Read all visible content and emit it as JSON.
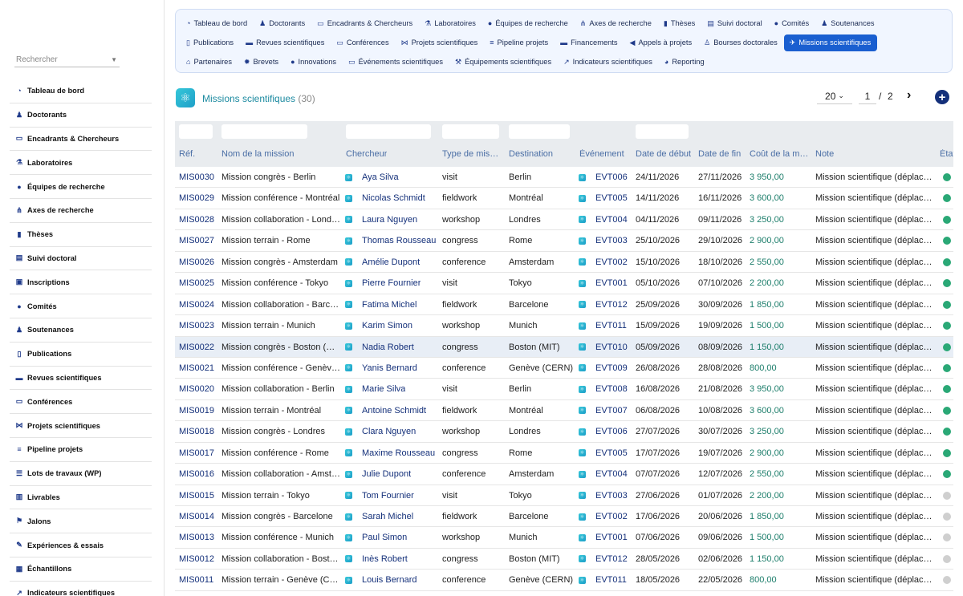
{
  "sidebar": {
    "search_placeholder": "Rechercher",
    "items": [
      {
        "label": "Tableau de bord",
        "icon": "dashboard-icon"
      },
      {
        "label": "Doctorants",
        "icon": "student-icon"
      },
      {
        "label": "Encadrants & Chercheurs",
        "icon": "researcher-icon"
      },
      {
        "label": "Laboratoires",
        "icon": "flask-icon"
      },
      {
        "label": "Équipes de recherche",
        "icon": "team-icon"
      },
      {
        "label": "Axes de recherche",
        "icon": "sitemap-icon"
      },
      {
        "label": "Thèses",
        "icon": "book-icon"
      },
      {
        "label": "Suivi doctoral",
        "icon": "clipboard-icon"
      },
      {
        "label": "Inscriptions",
        "icon": "id-card-icon"
      },
      {
        "label": "Comités",
        "icon": "committee-icon"
      },
      {
        "label": "Soutenances",
        "icon": "presenter-icon"
      },
      {
        "label": "Publications",
        "icon": "open-book-icon"
      },
      {
        "label": "Revues scientifiques",
        "icon": "journal-icon"
      },
      {
        "label": "Conférences",
        "icon": "conference-icon"
      },
      {
        "label": "Projets scientifiques",
        "icon": "project-icon"
      },
      {
        "label": "Pipeline projets",
        "icon": "pipeline-icon"
      },
      {
        "label": "Lots de travaux (WP)",
        "icon": "tasks-icon"
      },
      {
        "label": "Livrables",
        "icon": "deliverable-icon"
      },
      {
        "label": "Jalons",
        "icon": "flag-icon"
      },
      {
        "label": "Expériences & essais",
        "icon": "pen-icon"
      },
      {
        "label": "Échantillons",
        "icon": "sample-icon"
      },
      {
        "label": "Indicateurs scientifiques",
        "icon": "chart-icon"
      }
    ]
  },
  "topnav": {
    "rows": [
      [
        {
          "label": "Tableau de bord",
          "icon": "dashboard-icon"
        },
        {
          "label": "Doctorants",
          "icon": "student-icon"
        },
        {
          "label": "Encadrants & Chercheurs",
          "icon": "researcher-icon"
        },
        {
          "label": "Laboratoires",
          "icon": "flask-icon"
        },
        {
          "label": "Équipes de recherche",
          "icon": "team-icon"
        },
        {
          "label": "Axes de recherche",
          "icon": "sitemap-icon"
        },
        {
          "label": "Thèses",
          "icon": "book-icon"
        },
        {
          "label": "Suivi doctoral",
          "icon": "clipboard-icon"
        },
        {
          "label": "Comités",
          "icon": "committee-icon"
        },
        {
          "label": "Soutenances",
          "icon": "presenter-icon"
        }
      ],
      [
        {
          "label": "Publications",
          "icon": "open-book-icon"
        },
        {
          "label": "Revues scientifiques",
          "icon": "journal-icon"
        },
        {
          "label": "Conférences",
          "icon": "conference-icon"
        },
        {
          "label": "Projets scientifiques",
          "icon": "project-icon"
        },
        {
          "label": "Pipeline projets",
          "icon": "pipeline-icon"
        },
        {
          "label": "Financements",
          "icon": "money-icon"
        },
        {
          "label": "Appels à projets",
          "icon": "megaphone-icon"
        },
        {
          "label": "Bourses doctorales",
          "icon": "grant-icon"
        },
        {
          "label": "Missions scientifiques",
          "icon": "plane-icon",
          "active": true
        }
      ],
      [
        {
          "label": "Partenaires",
          "icon": "institution-icon"
        },
        {
          "label": "Brevets",
          "icon": "certificate-icon"
        },
        {
          "label": "Innovations",
          "icon": "lightbulb-icon"
        },
        {
          "label": "Événements scientifiques",
          "icon": "event-icon"
        },
        {
          "label": "Équipements scientifiques",
          "icon": "equipment-icon"
        },
        {
          "label": "Indicateurs scientifiques",
          "icon": "chart-icon"
        },
        {
          "label": "Reporting",
          "icon": "pie-chart-icon"
        }
      ]
    ]
  },
  "header": {
    "title": "Missions scientifiques",
    "count": "(30)",
    "per_page": "20",
    "page": "1",
    "slash": "/",
    "total_pages": "2"
  },
  "table": {
    "columns": [
      "Réf.",
      "Nom de la mission",
      "Chercheur",
      "Type de mis…",
      "Destination",
      "Événement",
      "Date de début",
      "Date de fin",
      "Coût de la m…",
      "Note",
      "État"
    ],
    "colors": {
      "done": "#2aa876",
      "pending": "#cfcfcf"
    },
    "rows": [
      {
        "ref": "MIS0030",
        "name": "Mission congrès - Berlin",
        "researcher": "Aya Silva",
        "type": "visit",
        "dest": "Berlin",
        "event": "EVT006",
        "start": "24/11/2026",
        "end": "27/11/2026",
        "cost": "3 950,00",
        "note": "Mission scientifique (déplac…",
        "status": "done"
      },
      {
        "ref": "MIS0029",
        "name": "Mission conférence - Montréal",
        "researcher": "Nicolas Schmidt",
        "type": "fieldwork",
        "dest": "Montréal",
        "event": "EVT005",
        "start": "14/11/2026",
        "end": "16/11/2026",
        "cost": "3 600,00",
        "note": "Mission scientifique (déplac…",
        "status": "done"
      },
      {
        "ref": "MIS0028",
        "name": "Mission collaboration - Lond…",
        "researcher": "Laura Nguyen",
        "type": "workshop",
        "dest": "Londres",
        "event": "EVT004",
        "start": "04/11/2026",
        "end": "09/11/2026",
        "cost": "3 250,00",
        "note": "Mission scientifique (déplac…",
        "status": "done"
      },
      {
        "ref": "MIS0027",
        "name": "Mission terrain - Rome",
        "researcher": "Thomas Rousseau",
        "type": "congress",
        "dest": "Rome",
        "event": "EVT003",
        "start": "25/10/2026",
        "end": "29/10/2026",
        "cost": "2 900,00",
        "note": "Mission scientifique (déplac…",
        "status": "done"
      },
      {
        "ref": "MIS0026",
        "name": "Mission congrès - Amsterdam",
        "researcher": "Amélie Dupont",
        "type": "conference",
        "dest": "Amsterdam",
        "event": "EVT002",
        "start": "15/10/2026",
        "end": "18/10/2026",
        "cost": "2 550,00",
        "note": "Mission scientifique (déplac…",
        "status": "done"
      },
      {
        "ref": "MIS0025",
        "name": "Mission conférence - Tokyo",
        "researcher": "Pierre Fournier",
        "type": "visit",
        "dest": "Tokyo",
        "event": "EVT001",
        "start": "05/10/2026",
        "end": "07/10/2026",
        "cost": "2 200,00",
        "note": "Mission scientifique (déplac…",
        "status": "done"
      },
      {
        "ref": "MIS0024",
        "name": "Mission collaboration - Barc…",
        "researcher": "Fatima Michel",
        "type": "fieldwork",
        "dest": "Barcelone",
        "event": "EVT012",
        "start": "25/09/2026",
        "end": "30/09/2026",
        "cost": "1 850,00",
        "note": "Mission scientifique (déplac…",
        "status": "done"
      },
      {
        "ref": "MIS0023",
        "name": "Mission terrain - Munich",
        "researcher": "Karim Simon",
        "type": "workshop",
        "dest": "Munich",
        "event": "EVT011",
        "start": "15/09/2026",
        "end": "19/09/2026",
        "cost": "1 500,00",
        "note": "Mission scientifique (déplac…",
        "status": "done"
      },
      {
        "ref": "MIS0022",
        "name": "Mission congrès - Boston (…",
        "researcher": "Nadia Robert",
        "type": "congress",
        "dest": "Boston (MIT)",
        "event": "EVT010",
        "start": "05/09/2026",
        "end": "08/09/2026",
        "cost": "1 150,00",
        "note": "Mission scientifique (déplac…",
        "status": "done",
        "highlight": true
      },
      {
        "ref": "MIS0021",
        "name": "Mission conférence - Genèv…",
        "researcher": "Yanis Bernard",
        "type": "conference",
        "dest": "Genève (CERN)",
        "event": "EVT009",
        "start": "26/08/2026",
        "end": "28/08/2026",
        "cost": "800,00",
        "note": "Mission scientifique (déplac…",
        "status": "done"
      },
      {
        "ref": "MIS0020",
        "name": "Mission collaboration - Berlin",
        "researcher": "Marie Silva",
        "type": "visit",
        "dest": "Berlin",
        "event": "EVT008",
        "start": "16/08/2026",
        "end": "21/08/2026",
        "cost": "3 950,00",
        "note": "Mission scientifique (déplac…",
        "status": "done"
      },
      {
        "ref": "MIS0019",
        "name": "Mission terrain - Montréal",
        "researcher": "Antoine Schmidt",
        "type": "fieldwork",
        "dest": "Montréal",
        "event": "EVT007",
        "start": "06/08/2026",
        "end": "10/08/2026",
        "cost": "3 600,00",
        "note": "Mission scientifique (déplac…",
        "status": "done"
      },
      {
        "ref": "MIS0018",
        "name": "Mission congrès - Londres",
        "researcher": "Clara Nguyen",
        "type": "workshop",
        "dest": "Londres",
        "event": "EVT006",
        "start": "27/07/2026",
        "end": "30/07/2026",
        "cost": "3 250,00",
        "note": "Mission scientifique (déplac…",
        "status": "done"
      },
      {
        "ref": "MIS0017",
        "name": "Mission conférence - Rome",
        "researcher": "Maxime Rousseau",
        "type": "congress",
        "dest": "Rome",
        "event": "EVT005",
        "start": "17/07/2026",
        "end": "19/07/2026",
        "cost": "2 900,00",
        "note": "Mission scientifique (déplac…",
        "status": "done"
      },
      {
        "ref": "MIS0016",
        "name": "Mission collaboration - Amst…",
        "researcher": "Julie Dupont",
        "type": "conference",
        "dest": "Amsterdam",
        "event": "EVT004",
        "start": "07/07/2026",
        "end": "12/07/2026",
        "cost": "2 550,00",
        "note": "Mission scientifique (déplac…",
        "status": "done"
      },
      {
        "ref": "MIS0015",
        "name": "Mission terrain - Tokyo",
        "researcher": "Tom Fournier",
        "type": "visit",
        "dest": "Tokyo",
        "event": "EVT003",
        "start": "27/06/2026",
        "end": "01/07/2026",
        "cost": "2 200,00",
        "note": "Mission scientifique (déplac…",
        "status": "pending"
      },
      {
        "ref": "MIS0014",
        "name": "Mission congrès - Barcelone",
        "researcher": "Sarah Michel",
        "type": "fieldwork",
        "dest": "Barcelone",
        "event": "EVT002",
        "start": "17/06/2026",
        "end": "20/06/2026",
        "cost": "1 850,00",
        "note": "Mission scientifique (déplac…",
        "status": "pending"
      },
      {
        "ref": "MIS0013",
        "name": "Mission conférence - Munich",
        "researcher": "Paul Simon",
        "type": "workshop",
        "dest": "Munich",
        "event": "EVT001",
        "start": "07/06/2026",
        "end": "09/06/2026",
        "cost": "1 500,00",
        "note": "Mission scientifique (déplac…",
        "status": "pending"
      },
      {
        "ref": "MIS0012",
        "name": "Mission collaboration - Bost…",
        "researcher": "Inès Robert",
        "type": "congress",
        "dest": "Boston (MIT)",
        "event": "EVT012",
        "start": "28/05/2026",
        "end": "02/06/2026",
        "cost": "1 150,00",
        "note": "Mission scientifique (déplac…",
        "status": "pending"
      },
      {
        "ref": "MIS0011",
        "name": "Mission terrain - Genève (C…",
        "researcher": "Louis Bernard",
        "type": "conference",
        "dest": "Genève (CERN)",
        "event": "EVT011",
        "start": "18/05/2026",
        "end": "22/05/2026",
        "cost": "800,00",
        "note": "Mission scientifique (déplac…",
        "status": "pending"
      }
    ]
  }
}
